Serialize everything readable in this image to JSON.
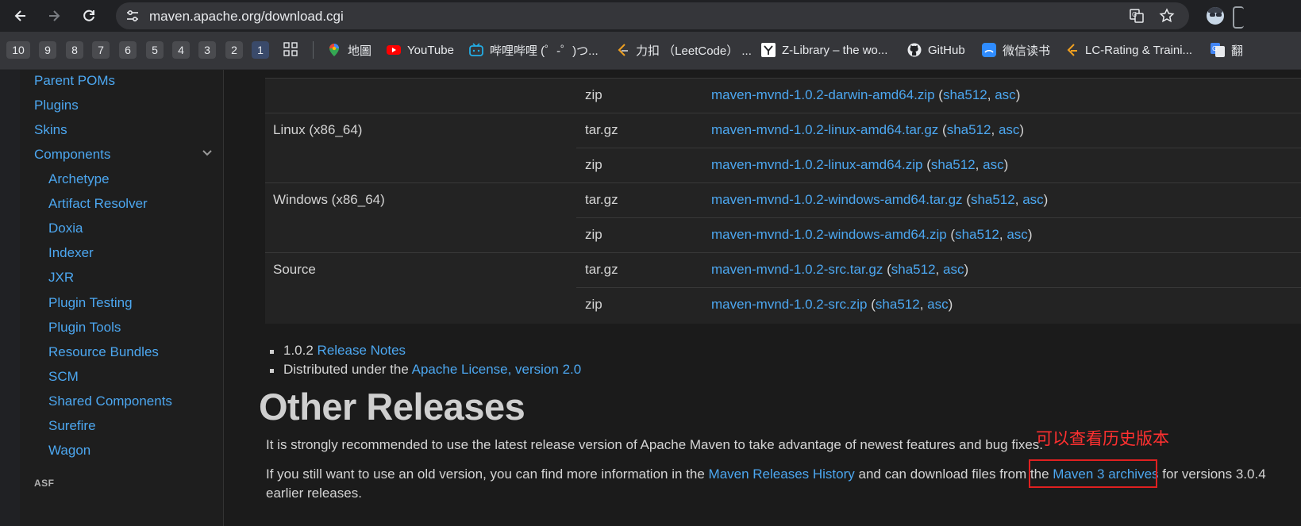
{
  "browser": {
    "url": "maven.apache.org/download.cgi",
    "tab_groups": [
      "10",
      "9",
      "8",
      "7",
      "6",
      "5",
      "4",
      "3",
      "2",
      "1"
    ],
    "bookmarks": [
      {
        "label": "地圖",
        "icon": "google-maps-icon"
      },
      {
        "label": "YouTube",
        "icon": "youtube-icon"
      },
      {
        "label": "哔哩哔哩 (゜-゜)つ...",
        "icon": "bilibili-icon"
      },
      {
        "label": "力扣 （LeetCode） ...",
        "icon": "leetcode-icon"
      },
      {
        "label": "Z-Library – the wo...",
        "icon": "zlibrary-icon"
      },
      {
        "label": "GitHub",
        "icon": "github-icon"
      },
      {
        "label": "微信读书",
        "icon": "weread-icon"
      },
      {
        "label": "LC-Rating & Traini...",
        "icon": "lc-rating-icon"
      },
      {
        "label": "翻",
        "icon": "google-translate-icon"
      }
    ]
  },
  "sidebar": {
    "top_items": [
      "Parent POMs",
      "Plugins",
      "Skins",
      "Components"
    ],
    "sub_items": [
      "Archetype",
      "Artifact Resolver",
      "Doxia",
      "Indexer",
      "JXR",
      "Plugin Testing",
      "Plugin Tools",
      "Resource Bundles",
      "SCM",
      "Shared Components",
      "Surefire",
      "Wagon"
    ],
    "section_label": "ASF"
  },
  "table": {
    "top_row": {
      "type": "zip",
      "file": "maven-mvnd-1.0.2-darwin-amd64.zip"
    },
    "platforms": [
      {
        "name": "Linux (x86_64)",
        "rows": [
          {
            "type": "tar.gz",
            "file": "maven-mvnd-1.0.2-linux-amd64.tar.gz"
          },
          {
            "type": "zip",
            "file": "maven-mvnd-1.0.2-linux-amd64.zip"
          }
        ]
      },
      {
        "name": "Windows (x86_64)",
        "rows": [
          {
            "type": "tar.gz",
            "file": "maven-mvnd-1.0.2-windows-amd64.tar.gz"
          },
          {
            "type": "zip",
            "file": "maven-mvnd-1.0.2-windows-amd64.zip"
          }
        ]
      },
      {
        "name": "Source",
        "rows": [
          {
            "type": "tar.gz",
            "file": "maven-mvnd-1.0.2-src.tar.gz"
          },
          {
            "type": "zip",
            "file": "maven-mvnd-1.0.2-src.zip"
          }
        ]
      }
    ],
    "checksum_label": "sha512",
    "signature_label": "asc",
    "open_paren": "(",
    "separator": ",",
    "close_paren": ")"
  },
  "notes": {
    "version_text": "1.0.2",
    "release_notes_link": "Release Notes",
    "license_prefix": "Distributed under the",
    "license_link": "Apache License, version 2.0"
  },
  "other_releases": {
    "heading": "Other Releases",
    "para1": "It is strongly recommended to use the latest release version of Apache Maven to take advantage of newest features and bug fixes.",
    "para2_prefix": "If you still want to use an old version, you can find more information in the",
    "history_link": "Maven Releases History",
    "para2_middle": "and can download files from the",
    "archives_link": "Maven 3 archives",
    "para2_suffix": "for versions 3.0.4",
    "para2_line2": "earlier releases."
  },
  "annotation": {
    "text": "可以查看历史版本",
    "color": "#ff3030"
  }
}
